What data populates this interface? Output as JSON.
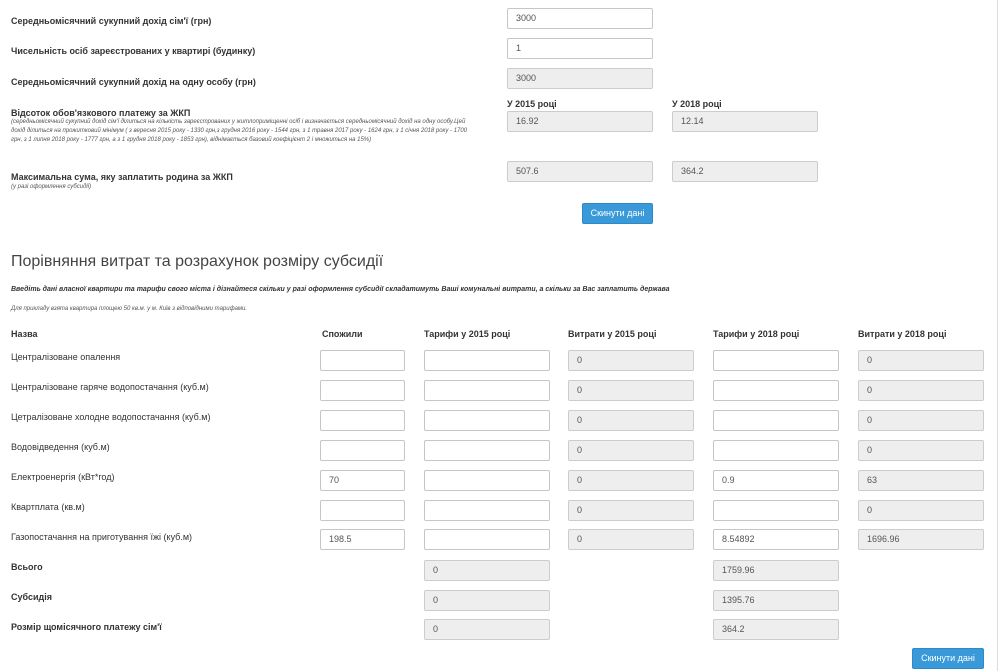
{
  "form": {
    "avg_income_label": "Середньомісячний сукупний дохід сім'ї (грн)",
    "avg_income_value": "3000",
    "persons_label": "Чисельність осіб зареєстрованих у квартирі (будинку)",
    "persons_value": "1",
    "per_person_label": "Середньомісячний сукупний дохід на одну особу (грн)",
    "per_person_value": "3000",
    "year_2015_label": "У 2015 році",
    "year_2018_label": "У 2018 році",
    "percent_label": "Відсоток обов'язкового платежу за ЖКП",
    "percent_note": "(середньомісячний сукупний дохід сім'ї ділиться на кількість зареєстрованих у житлоприміщенні осіб і визначається середньомісячний дохід на одну особу.Цей дохід ділиться на прожитковий мінімум ( з вересня 2015 року - 1330 грн,з грудня 2016 року - 1544 грн, з 1 травня 2017 року - 1624 грн, з 1 січня 2018 року - 1700 грн, з 1 липня 2018 року - 1777 грн, а з 1 грудня 2018 року - 1853 грн), віднімається базовий коефіцієнт 2 і множиться на 15%)",
    "percent_2015": "16.92",
    "percent_2018": "12.14",
    "max_sum_label": "Максимальна сума, яку заплатить родина за ЖКП",
    "max_sum_note": "(у разі оформлення субсидії)",
    "max_sum_2015": "507.6",
    "max_sum_2018": "364.2",
    "reset_label": "Скинути дані"
  },
  "section": {
    "title": "Порівняння витрат та розрахунок розміру субсидії",
    "intro": "Введіть дані власної квартири та тарифи свого міста і дізнайтеся скільки у разі оформлення субсидії складатимуть Ваші комунальні витрати, а скільки за Вас заплатить держава",
    "example": "Для прикладу взята квартира площею 50 кв.м. у м. Київ з відповідними тарифами."
  },
  "table": {
    "headers": [
      "Назва",
      "Спожили",
      "Тарифи у 2015 році",
      "Витрати у 2015 році",
      "Тарифи у 2018 році",
      "Витрати у 2018 році"
    ],
    "rows": [
      {
        "name": "Централізоване опалення",
        "used": "",
        "tariff2015": "",
        "cost2015": "0",
        "tariff2018": "",
        "cost2018": "0"
      },
      {
        "name": "Централізоване гаряче водопостачання (куб.м)",
        "used": "",
        "tariff2015": "",
        "cost2015": "0",
        "tariff2018": "",
        "cost2018": "0"
      },
      {
        "name": "Цетралізоване холодне водопостачання (куб.м)",
        "used": "",
        "tariff2015": "",
        "cost2015": "0",
        "tariff2018": "",
        "cost2018": "0"
      },
      {
        "name": "Водовідведення (куб.м)",
        "used": "",
        "tariff2015": "",
        "cost2015": "0",
        "tariff2018": "",
        "cost2018": "0"
      },
      {
        "name": "Електроенергія (кВт*год)",
        "used": "70",
        "tariff2015": "",
        "cost2015": "0",
        "tariff2018": "0.9",
        "cost2018": "63"
      },
      {
        "name": "Квартплата (кв.м)",
        "used": "",
        "tariff2015": "",
        "cost2015": "0",
        "tariff2018": "",
        "cost2018": "0"
      },
      {
        "name": "Газопостачання на приготування їжі (куб.м)",
        "used": "198.5",
        "tariff2015": "",
        "cost2015": "0",
        "tariff2018": "8.54892",
        "cost2018": "1696.96"
      }
    ],
    "totals": [
      {
        "label": "Всього",
        "v2015": "0",
        "v2018": "1759.96"
      },
      {
        "label": "Субсидія",
        "v2015": "0",
        "v2018": "1395.76"
      },
      {
        "label": "Розмір щомісячного платежу сім'ї",
        "v2015": "0",
        "v2018": "364.2"
      }
    ],
    "reset_label": "Скинути дані"
  },
  "colors": {
    "accent": "#3a9ad9",
    "readonly_bg": "#eeeeee"
  }
}
